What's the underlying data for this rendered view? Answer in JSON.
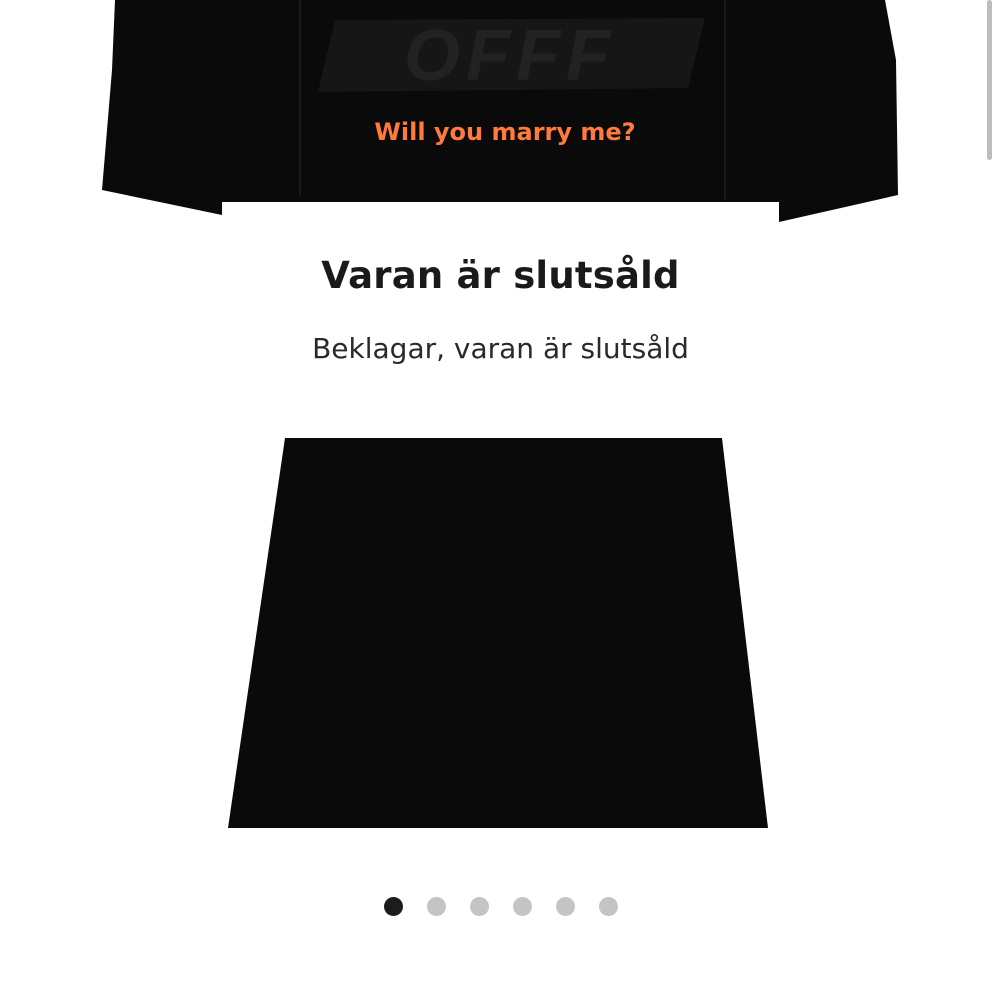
{
  "product": {
    "graphic_logo_text": "OFFF",
    "graphic_slogan": "Will you marry me?",
    "colors": {
      "shirt": "#0a0a0a",
      "print": "#ff7a3d",
      "background": "#ffffff"
    }
  },
  "soldout": {
    "title": "Varan är slutsåld",
    "message": "Beklagar, varan är slutsåld"
  },
  "pager": {
    "count": 6,
    "active_index": 0,
    "colors": {
      "active": "#1c1c1c",
      "inactive": "#c4c4c4"
    }
  }
}
